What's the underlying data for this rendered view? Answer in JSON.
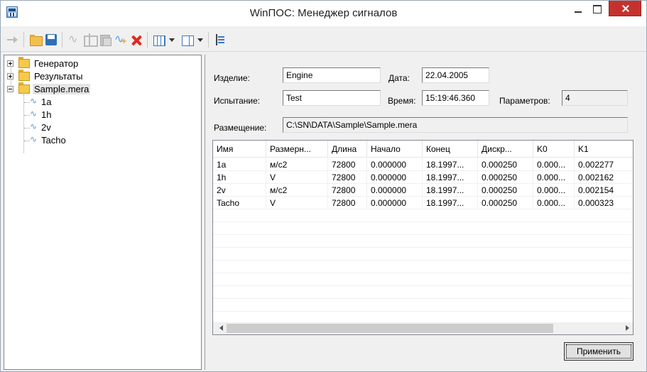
{
  "window": {
    "title": "WinПОС: Менеджер сигналов",
    "icon": "winpos-app-icon"
  },
  "toolbar": {
    "buttons": [
      {
        "name": "export",
        "icon": "export-arrow-icon",
        "enabled": false
      },
      {
        "name": "open",
        "icon": "folder-open-icon",
        "enabled": true
      },
      {
        "name": "save",
        "icon": "floppy-disk-icon",
        "enabled": true
      },
      {
        "name": "signal",
        "icon": "signal-wave-icon",
        "enabled": false
      },
      {
        "name": "split",
        "icon": "split-icon",
        "enabled": false
      },
      {
        "name": "copy",
        "icon": "copy-icon",
        "enabled": false
      },
      {
        "name": "new-signal",
        "icon": "new-signal-icon",
        "enabled": true
      },
      {
        "name": "delete",
        "icon": "delete-x-icon",
        "enabled": true
      },
      {
        "name": "view-columns",
        "icon": "columns-view-icon",
        "enabled": true
      },
      {
        "name": "view-panels",
        "icon": "panels-view-icon",
        "enabled": true
      },
      {
        "name": "tree-view",
        "icon": "tree-view-icon",
        "enabled": true
      }
    ]
  },
  "tree": {
    "nodes": [
      {
        "label": "Генератор",
        "type": "folder",
        "expanded": false
      },
      {
        "label": "Результаты",
        "type": "folder",
        "expanded": false
      },
      {
        "label": "Sample.mera",
        "type": "folder",
        "expanded": true,
        "selected": true,
        "children": [
          "1a",
          "1h",
          "2v",
          "Tacho"
        ]
      }
    ]
  },
  "details": {
    "product_label": "Изделие:",
    "product_value": "Engine",
    "date_label": "Дата:",
    "date_value": "22.04.2005",
    "test_label": "Испытание:",
    "test_value": "Test",
    "time_label": "Время:",
    "time_value": "15:19:46.360",
    "params_label": "Параметров:",
    "params_value": "4",
    "location_label": "Размещение:",
    "location_value": "C:\\SN\\DATA\\Sample\\Sample.mera"
  },
  "grid": {
    "columns": [
      "Имя",
      "Размерн...",
      "Длина",
      "Начало",
      "Конец",
      "Дискр...",
      "K0",
      "K1"
    ],
    "rows": [
      [
        "1a",
        "м/с2",
        "72800",
        "0.000000",
        "18.1997...",
        "0.000250",
        "0.000...",
        "0.002277"
      ],
      [
        "1h",
        "V",
        "72800",
        "0.000000",
        "18.1997...",
        "0.000250",
        "0.000...",
        "0.002162"
      ],
      [
        "2v",
        "м/с2",
        "72800",
        "0.000000",
        "18.1997...",
        "0.000250",
        "0.000...",
        "0.002154"
      ],
      [
        "Tacho",
        "V",
        "72800",
        "0.000000",
        "18.1997...",
        "0.000250",
        "0.000...",
        "0.000323"
      ]
    ]
  },
  "apply_button": "Применить"
}
